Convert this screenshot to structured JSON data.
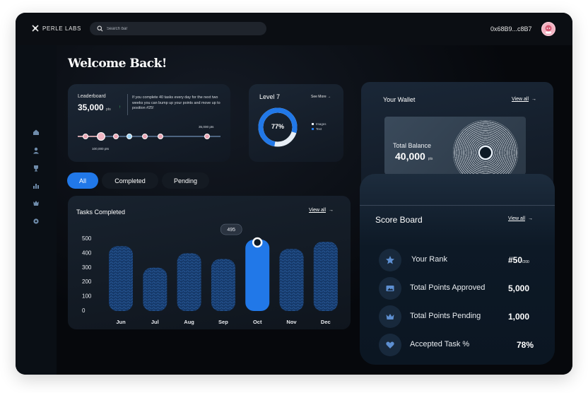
{
  "brand": {
    "name": "PERLE LABS"
  },
  "search": {
    "placeholder": "Search bar"
  },
  "header": {
    "wallet_address": "0x68B9...c8B7"
  },
  "welcome": "Welcome Back!",
  "leaderboard": {
    "title": "Leaderboard",
    "points": "35,000",
    "points_unit": "pts",
    "trend_icon": "arrow-up-icon",
    "message": "If you complete 40 tasks every day for the next two weeks you can bump up your points and move up to position #25!",
    "label_low": "100,000 pts",
    "label_high": "35,000 pts"
  },
  "level": {
    "title": "Level 7",
    "see_more": "See More",
    "percent": "77%",
    "percent_value": 77,
    "legend": [
      {
        "label": "Images",
        "color": "#e6edf5"
      },
      {
        "label": "Text",
        "color": "#2178e8"
      }
    ]
  },
  "wallet": {
    "title": "Your Wallet",
    "view_all": "View all",
    "balance_label": "Total Balance",
    "balance_value": "40,000",
    "balance_unit": "pts"
  },
  "tabs": [
    {
      "label": "All",
      "active": true
    },
    {
      "label": "Completed",
      "active": false
    },
    {
      "label": "Pending",
      "active": false
    }
  ],
  "tasks": {
    "title": "Tasks Completed",
    "view_all": "View all",
    "highlight_label": "495"
  },
  "chart_data": {
    "type": "bar",
    "title": "Tasks Completed",
    "categories": [
      "Jun",
      "Jul",
      "Aug",
      "Sep",
      "Oct",
      "Nov",
      "Dec"
    ],
    "values": [
      450,
      300,
      400,
      360,
      495,
      430,
      480
    ],
    "y_ticks": [
      "500",
      "400",
      "300",
      "200",
      "100",
      "0"
    ],
    "ylim": [
      0,
      500
    ],
    "highlight_index": 4,
    "colors": {
      "bar": "#1d4a86",
      "highlight": "#2178e8"
    },
    "grid": false
  },
  "scoreboard": {
    "title": "Score Board",
    "view_all": "View all",
    "rows": [
      {
        "icon": "star-icon",
        "label": "Your Rank",
        "value": "#50",
        "suffix": "/200"
      },
      {
        "icon": "image-icon",
        "label": "Total Points Approved",
        "value": "5,000",
        "suffix": ""
      },
      {
        "icon": "crown-icon",
        "label": "Total Points Pending",
        "value": "1,000",
        "suffix": ""
      },
      {
        "icon": "heart-icon",
        "label": "Accepted Task %",
        "value": "78%",
        "suffix": ""
      }
    ]
  },
  "sidebar": [
    {
      "icon": "home-icon"
    },
    {
      "icon": "user-icon"
    },
    {
      "icon": "trophy-icon"
    },
    {
      "icon": "chart-icon"
    },
    {
      "icon": "badge-icon"
    },
    {
      "icon": "settings-icon"
    }
  ]
}
